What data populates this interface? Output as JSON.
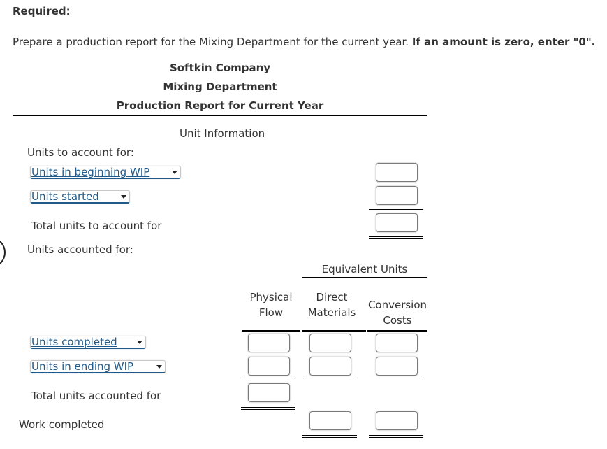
{
  "required_label": "Required:",
  "instructions": {
    "text": "Prepare a production report for the Mixing Department for the current year.",
    "bold": "If an amount is zero, enter \"0\"."
  },
  "report": {
    "company": "Softkin Company",
    "department": "Mixing Department",
    "title": "Production Report for Current Year",
    "section_title": "Unit Information",
    "units_to_account_for_label": "Units to account for:",
    "to_account_rows": [
      {
        "select_value": "Units in beginning WIP",
        "input_value": ""
      },
      {
        "select_value": "Units started",
        "input_value": ""
      }
    ],
    "total_to_account_label": "Total units to account for",
    "total_to_account_value": "",
    "units_accounted_for_label": "Units accounted for:",
    "equivalent_units_header": "Equivalent Units",
    "columns": {
      "physical_flow": [
        "Physical",
        "Flow"
      ],
      "direct_materials": [
        "Direct",
        "Materials"
      ],
      "conversion_costs": [
        "Conversion",
        "Costs"
      ]
    },
    "accounted_rows": [
      {
        "select_value": "Units completed",
        "physical_flow": "",
        "direct_materials": "",
        "conversion_costs": ""
      },
      {
        "select_value": "Units in ending WIP",
        "physical_flow": "",
        "direct_materials": "",
        "conversion_costs": ""
      }
    ],
    "total_accounted_label": "Total units accounted for",
    "total_accounted_value": "",
    "work_completed_label": "Work completed",
    "work_completed": {
      "direct_materials": "",
      "conversion_costs": ""
    }
  },
  "colors": {
    "select_text": "#1f5a8a",
    "body_text": "#333333"
  }
}
